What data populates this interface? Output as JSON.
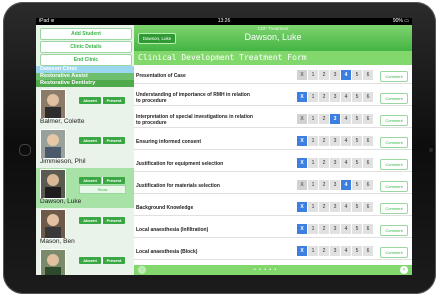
{
  "status": {
    "left": "iPad ≋",
    "time": "13:26",
    "right": "90% ▭"
  },
  "sidebar": {
    "buttons": [
      {
        "label": "Add Student"
      },
      {
        "label": "Clinic Details"
      },
      {
        "label": "End Clinic"
      }
    ],
    "menu": [
      {
        "label": "Dawson Clinic"
      },
      {
        "label": "Restorative Assist"
      },
      {
        "label": "Restorative Dentistry"
      }
    ],
    "students": [
      {
        "name": "Balmer, Colette",
        "absent": "Absent",
        "present": "Present",
        "extra": ""
      },
      {
        "name": "Jimmieson, Phil",
        "absent": "Absent",
        "present": "Present",
        "extra": ""
      },
      {
        "name": "Dawson, Luke",
        "absent": "Absent",
        "present": "Present",
        "extra": "Show"
      },
      {
        "name": "Mason, Ben",
        "absent": "Absent",
        "present": "Present",
        "extra": ""
      }
    ]
  },
  "header": {
    "caption": "CDF Treatment",
    "back": "Dawson, Luke",
    "patient": "Dawson, Luke"
  },
  "form_title": "Clinical Development Treatment Form",
  "comment_label": "Comment",
  "scale_labels": [
    "X",
    "1",
    "2",
    "3",
    "4",
    "5",
    "6"
  ],
  "rows": [
    {
      "label": "Presentation of Case",
      "selected": 4
    },
    {
      "label": "Understanding of importance of RMH in relation to procedure",
      "selected": 0
    },
    {
      "label": "Interpretation of special investigations in relation to procedure",
      "selected": 3
    },
    {
      "label": "Ensuring informed consent",
      "selected": 0
    },
    {
      "label": "Justification for equipment selection",
      "selected": 0
    },
    {
      "label": "Justification for materials selection",
      "selected": 4
    },
    {
      "label": "Background Knowledge",
      "selected": 0
    },
    {
      "label": "Local anaesthesia (Infiltration)",
      "selected": 0
    },
    {
      "label": "Local anaesthesia (Block)",
      "selected": 0
    }
  ],
  "bottom": {
    "dots": "• • • • •",
    "prev": "‹",
    "next": "›"
  }
}
